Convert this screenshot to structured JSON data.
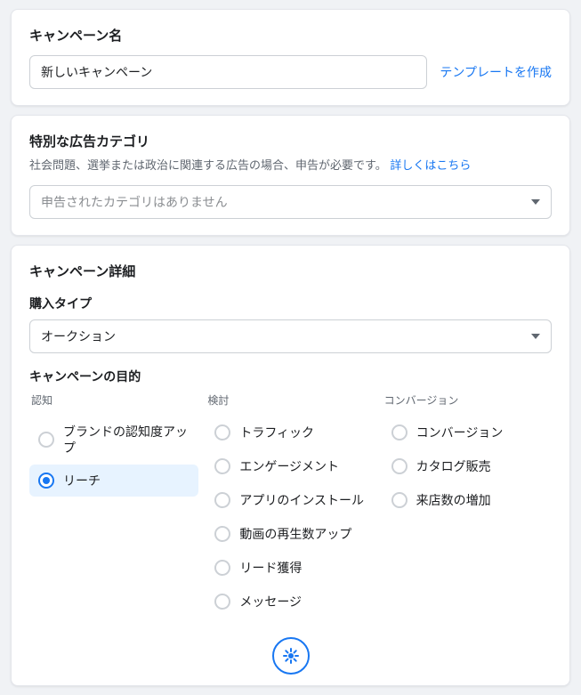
{
  "campaign_name": {
    "title": "キャンペーン名",
    "value": "新しいキャンペーン",
    "template_link": "テンプレートを作成"
  },
  "special_category": {
    "title": "特別な広告カテゴリ",
    "desc": "社会問題、選挙または政治に関連する広告の場合、申告が必要です。",
    "learn_more": "詳しくはこちら",
    "dropdown_value": "申告されたカテゴリはありません"
  },
  "details": {
    "title": "キャンペーン詳細",
    "buying_type_label": "購入タイプ",
    "buying_type_value": "オークション",
    "objective_label": "キャンペーンの目的",
    "columns": {
      "awareness": {
        "header": "認知",
        "items": [
          {
            "label": "ブランドの認知度アップ",
            "selected": false
          },
          {
            "label": "リーチ",
            "selected": true
          }
        ]
      },
      "consideration": {
        "header": "検討",
        "items": [
          {
            "label": "トラフィック",
            "selected": false
          },
          {
            "label": "エンゲージメント",
            "selected": false
          },
          {
            "label": "アプリのインストール",
            "selected": false
          },
          {
            "label": "動画の再生数アップ",
            "selected": false
          },
          {
            "label": "リード獲得",
            "selected": false
          },
          {
            "label": "メッセージ",
            "selected": false
          }
        ]
      },
      "conversion": {
        "header": "コンバージョン",
        "items": [
          {
            "label": "コンバージョン",
            "selected": false
          },
          {
            "label": "カタログ販売",
            "selected": false
          },
          {
            "label": "来店数の増加",
            "selected": false
          }
        ]
      }
    }
  }
}
